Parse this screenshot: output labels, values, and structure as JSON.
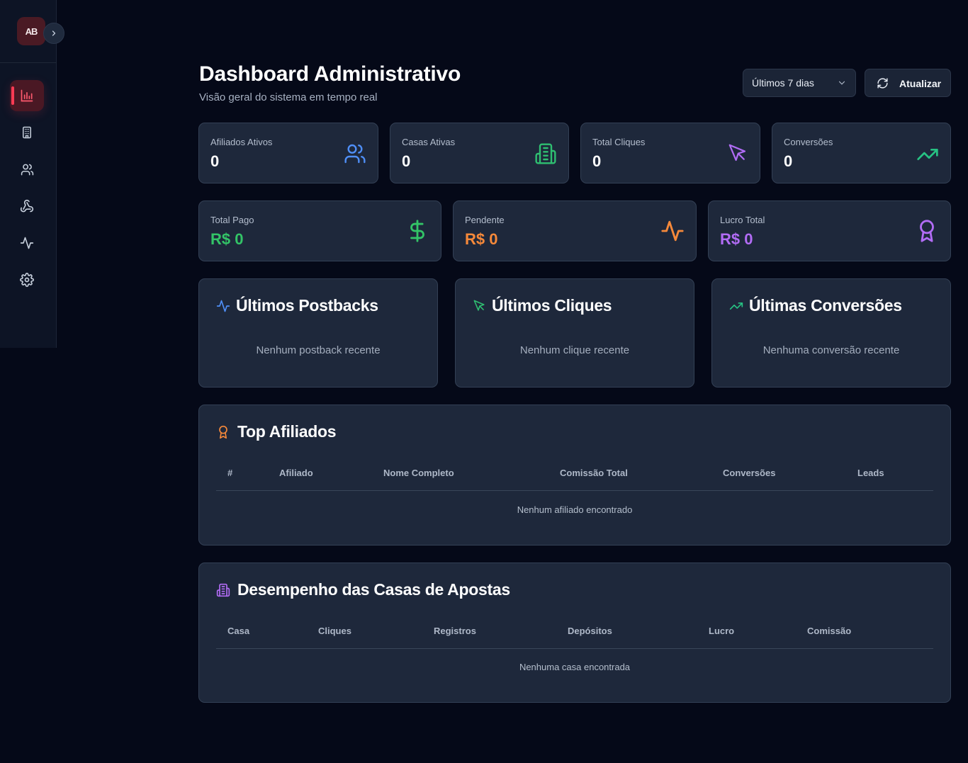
{
  "sidebar": {
    "logo_text": "AB",
    "items": [
      {
        "name": "dashboard",
        "icon": "bar-chart-icon",
        "active": true
      },
      {
        "name": "casas",
        "icon": "building-icon",
        "active": false
      },
      {
        "name": "afiliados",
        "icon": "users-icon",
        "active": false
      },
      {
        "name": "webhooks",
        "icon": "webhook-icon",
        "active": false
      },
      {
        "name": "atividade",
        "icon": "activity-icon",
        "active": false
      },
      {
        "name": "configuracoes",
        "icon": "settings-icon",
        "active": false
      }
    ]
  },
  "header": {
    "title": "Dashboard Administrativo",
    "subtitle": "Visão geral do sistema em tempo real",
    "period_value": "Últimos 7 dias",
    "refresh_label": "Atualizar"
  },
  "stats_top": [
    {
      "label": "Afiliados Ativos",
      "value": "0",
      "icon": "users-icon",
      "color": "#4f8ff7"
    },
    {
      "label": "Casas Ativas",
      "value": "0",
      "icon": "building-icon",
      "color": "#2fbf71"
    },
    {
      "label": "Total Cliques",
      "value": "0",
      "icon": "cursor-icon",
      "color": "#b06cf4"
    },
    {
      "label": "Conversões",
      "value": "0",
      "icon": "trending-up-icon",
      "color": "#27c283"
    }
  ],
  "stats_money": [
    {
      "label": "Total Pago",
      "value": "R$ 0",
      "icon": "dollar-icon",
      "color": "#33c467"
    },
    {
      "label": "Pendente",
      "value": "R$ 0",
      "icon": "activity-icon",
      "color": "#f6893a"
    },
    {
      "label": "Lucro Total",
      "value": "R$ 0",
      "icon": "award-icon",
      "color": "#b26cf5"
    }
  ],
  "activity": [
    {
      "title": "Últimos Postbacks",
      "empty": "Nenhum postback recente",
      "icon": "activity-icon",
      "color": "#4f8ff7"
    },
    {
      "title": "Últimos Cliques",
      "empty": "Nenhum clique recente",
      "icon": "cursor-icon",
      "color": "#2fbf71"
    },
    {
      "title": "Últimas Conversões",
      "empty": "Nenhuma conversão recente",
      "icon": "trending-up-icon",
      "color": "#27c283"
    }
  ],
  "top_affiliates": {
    "title": "Top Afiliados",
    "columns": [
      "#",
      "Afiliado",
      "Nome Completo",
      "Comissão Total",
      "Conversões",
      "Leads"
    ],
    "empty": "Nenhum afiliado encontrado",
    "icon_color": "#f6893a"
  },
  "houses_performance": {
    "title": "Desempenho das Casas de Apostas",
    "columns": [
      "Casa",
      "Cliques",
      "Registros",
      "Depósitos",
      "Lucro",
      "Comissão"
    ],
    "empty": "Nenhuma casa encontrada",
    "icon_color": "#b26cf5"
  }
}
